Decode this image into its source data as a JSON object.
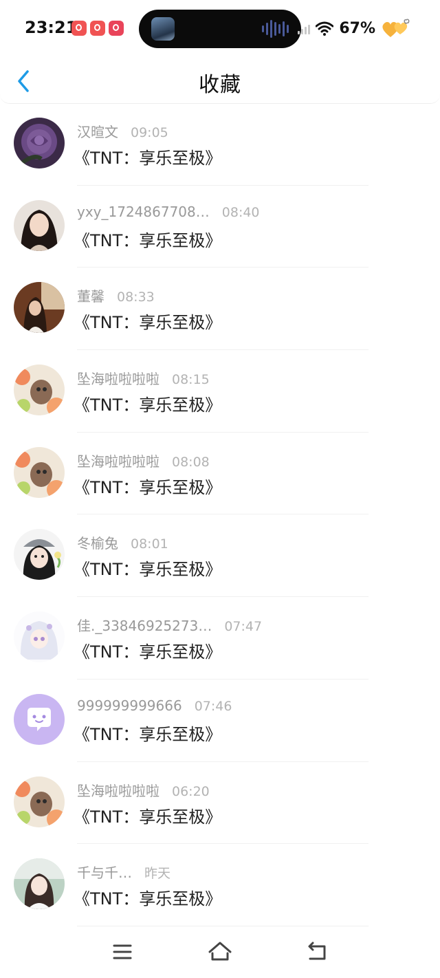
{
  "status_bar": {
    "time": "23:21",
    "battery": "67%",
    "app_icons": [
      "douyin-icon",
      "douyin-icon",
      "red-app-icon"
    ]
  },
  "header": {
    "title": "收藏",
    "back_icon": "chevron-left-icon"
  },
  "colors": {
    "accent": "#1e9be6",
    "name_gray": "#999999",
    "divider": "#f0f0f0"
  },
  "items": [
    {
      "name": "汉暄文",
      "time": "09:05",
      "message": "《TNT：享乐至极》",
      "avatar": "purple-rose-avatar"
    },
    {
      "name": "yxy_1724867708…",
      "time": "08:40",
      "message": "《TNT：享乐至极》",
      "avatar": "girl-portrait-avatar"
    },
    {
      "name": "董馨",
      "time": "08:33",
      "message": "《TNT：享乐至极》",
      "avatar": "girl-indoor-avatar"
    },
    {
      "name": "坠海啦啦啦啦",
      "time": "08:15",
      "message": "《TNT：享乐至极》",
      "avatar": "flower-cat-avatar"
    },
    {
      "name": "坠海啦啦啦啦",
      "time": "08:08",
      "message": "《TNT：享乐至极》",
      "avatar": "flower-cat-avatar"
    },
    {
      "name": "冬榆兔",
      "time": "08:01",
      "message": "《TNT：享乐至极》",
      "avatar": "anime-girl-avatar"
    },
    {
      "name": "佳._33846925273…",
      "time": "07:47",
      "message": "《TNT：享乐至极》",
      "avatar": "anime-white-hair-avatar"
    },
    {
      "name": "999999999666",
      "time": "07:46",
      "message": "《TNT：享乐至极》",
      "avatar": "chat-bubble-default-avatar"
    },
    {
      "name": "坠海啦啦啦啦",
      "time": "06:20",
      "message": "《TNT：享乐至极》",
      "avatar": "flower-cat-avatar"
    },
    {
      "name": "千与千…",
      "time": "昨天",
      "message": "《TNT：享乐至极》",
      "avatar": "girl-outdoor-avatar"
    }
  ],
  "nav_bar": {
    "menu_icon": "menu-icon",
    "home_icon": "home-icon",
    "back_icon": "back-arrow-icon"
  }
}
